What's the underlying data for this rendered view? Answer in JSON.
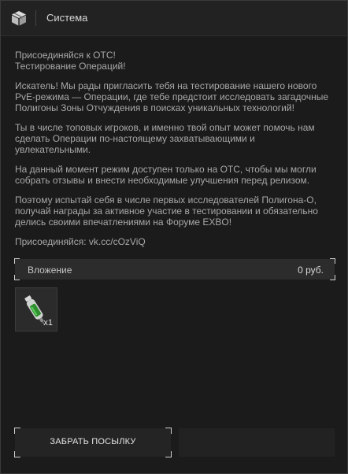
{
  "header": {
    "title": "Система",
    "icon": "package-icon"
  },
  "message": {
    "paragraphs": [
      "Присоединяйся к ОТС!\nТестирование Операций!",
      "Искатель! Мы рады пригласить тебя на тестирование нашего нового PvE-режима — Операции, где тебе предстоит исследовать загадочные Полигоны Зоны Отчуждения в поисках уникальных технологий!",
      "Ты в числе топовых игроков, и именно твой опыт может помочь нам сделать Операции по-настоящему захватывающими и увлекательными.",
      "На данный момент режим доступен только на ОТС, чтобы мы могли собрать отзывы и внести необходимые улучшения перед релизом.",
      "Поэтому испытай себя в числе первых исследователей Полигона-О, получай награды за активное участие в тестировании и обязательно делись своими впечатлениями на Форуме EXBO!",
      "Присоединяйся: vk.cc/cOzViQ"
    ]
  },
  "attachment": {
    "label": "Вложение",
    "amount": "0 руб."
  },
  "items": [
    {
      "icon": "syringe-icon",
      "quantity": "x1"
    }
  ],
  "actions": {
    "claim_label": "ЗАБРАТЬ ПОСЫЛКУ"
  },
  "colors": {
    "background": "#1b1b1b",
    "header": "#222222",
    "text": "#a8a8a8",
    "item_green": "#3aa23a"
  }
}
